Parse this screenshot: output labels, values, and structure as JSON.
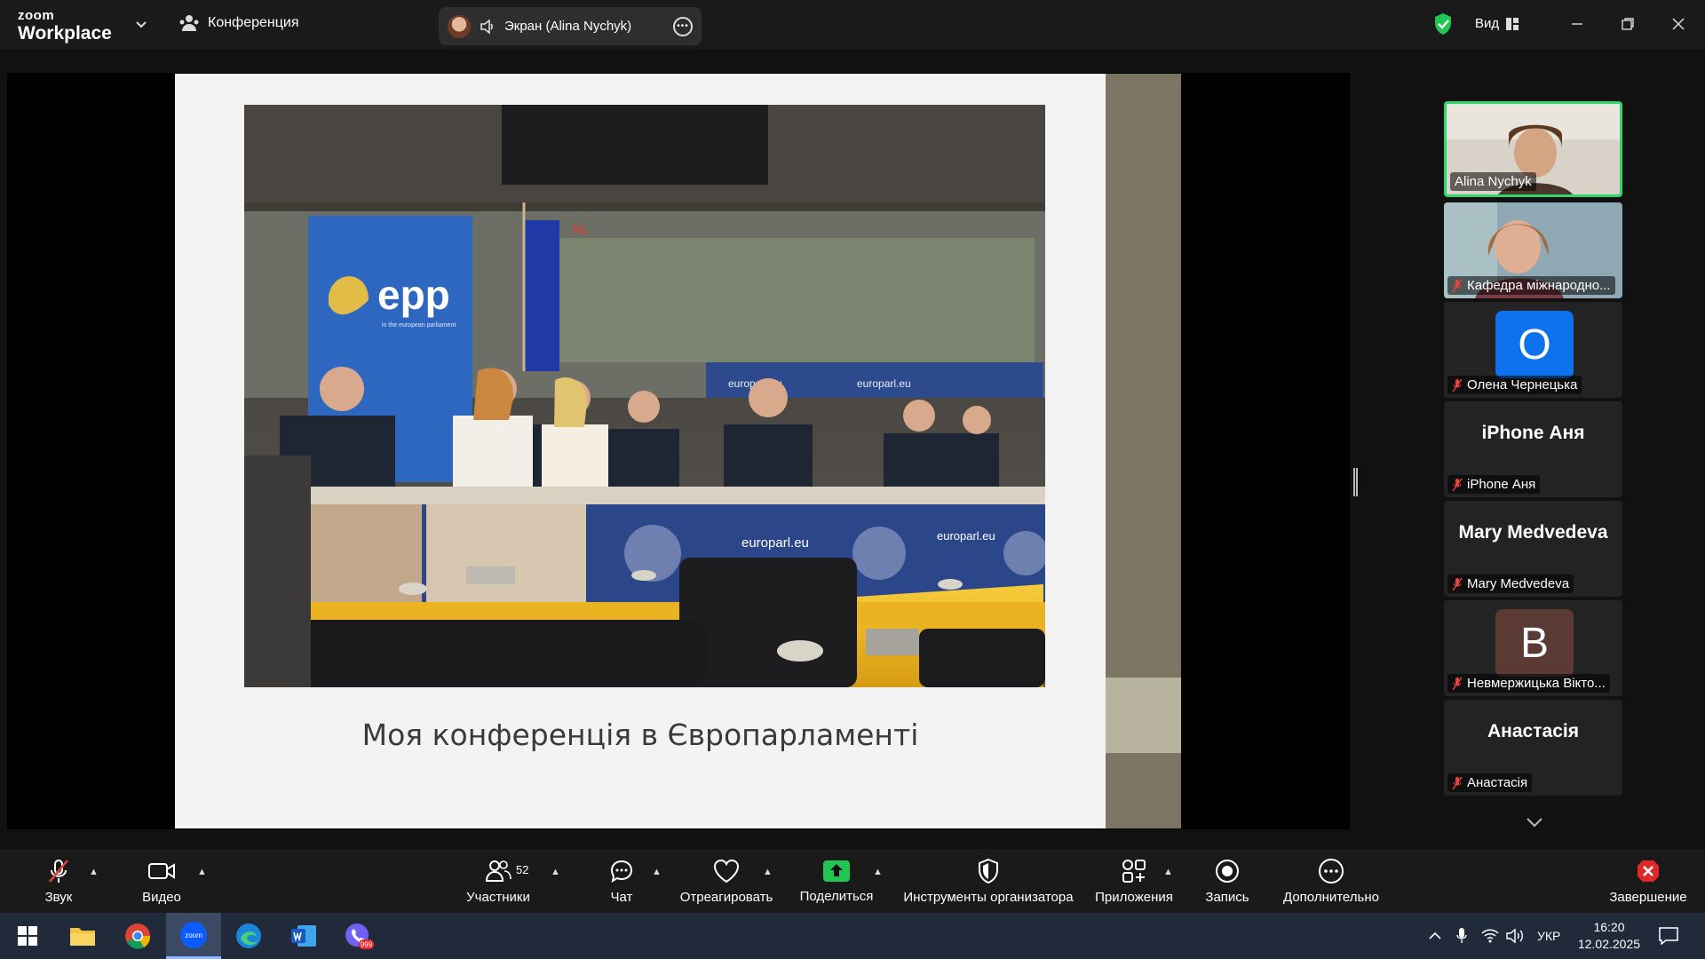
{
  "app": {
    "logo_small": "zoom",
    "logo_big": "Workplace",
    "meeting_label": "Конференция",
    "share_label": "Экран (Alina Nychyk)",
    "view_label": "Вид"
  },
  "slide": {
    "caption": "Моя конференція в Європарламенті",
    "photo_texts": {
      "banner": "epp",
      "banner_sub": "in the european parliament",
      "screen": "NL",
      "desk1": "europarl.eu",
      "desk2": "europarl.eu",
      "desk3": "europarl.eu",
      "wall1": "europarl.eu",
      "wall2": "europarl.eu"
    }
  },
  "participants": [
    {
      "name": "Alina Nychyk",
      "type": "video",
      "active": true,
      "muted": false
    },
    {
      "name": "Кафедра міжнародно...",
      "type": "video",
      "active": false,
      "muted": true
    },
    {
      "name": "Олена Чернецька",
      "type": "avatar",
      "initial": "О",
      "color": "#0e72ed",
      "muted": true
    },
    {
      "name": "iPhone Аня",
      "type": "text",
      "big": "iPhone Аня",
      "muted": true
    },
    {
      "name": "Mary Medvedeva",
      "type": "text",
      "big": "Mary Medvedeva",
      "muted": true
    },
    {
      "name": "Невмержицька Вікто...",
      "type": "avatar",
      "initial": "В",
      "color": "#5a3a32",
      "muted": true
    },
    {
      "name": "Анастасія",
      "type": "text",
      "big": "Анастасія",
      "muted": true
    }
  ],
  "toolbar": {
    "audio": "Звук",
    "video": "Видео",
    "participants": "Участники",
    "participants_count": "52",
    "chat": "Чат",
    "react": "Отреагировать",
    "share": "Поделиться",
    "host_tools": "Инструменты организатора",
    "apps": "Приложения",
    "record": "Запись",
    "more": "Дополнительно",
    "end": "Завершение"
  },
  "taskbar": {
    "lang": "УКР",
    "time": "16:20",
    "date": "12.02.2025",
    "viber_badge": "999",
    "zoom_label": "zoom"
  },
  "colors": {
    "active_border": "#2fd66d",
    "share_green": "#23c552",
    "end_red": "#e02828",
    "muted_red": "#e8413b"
  }
}
